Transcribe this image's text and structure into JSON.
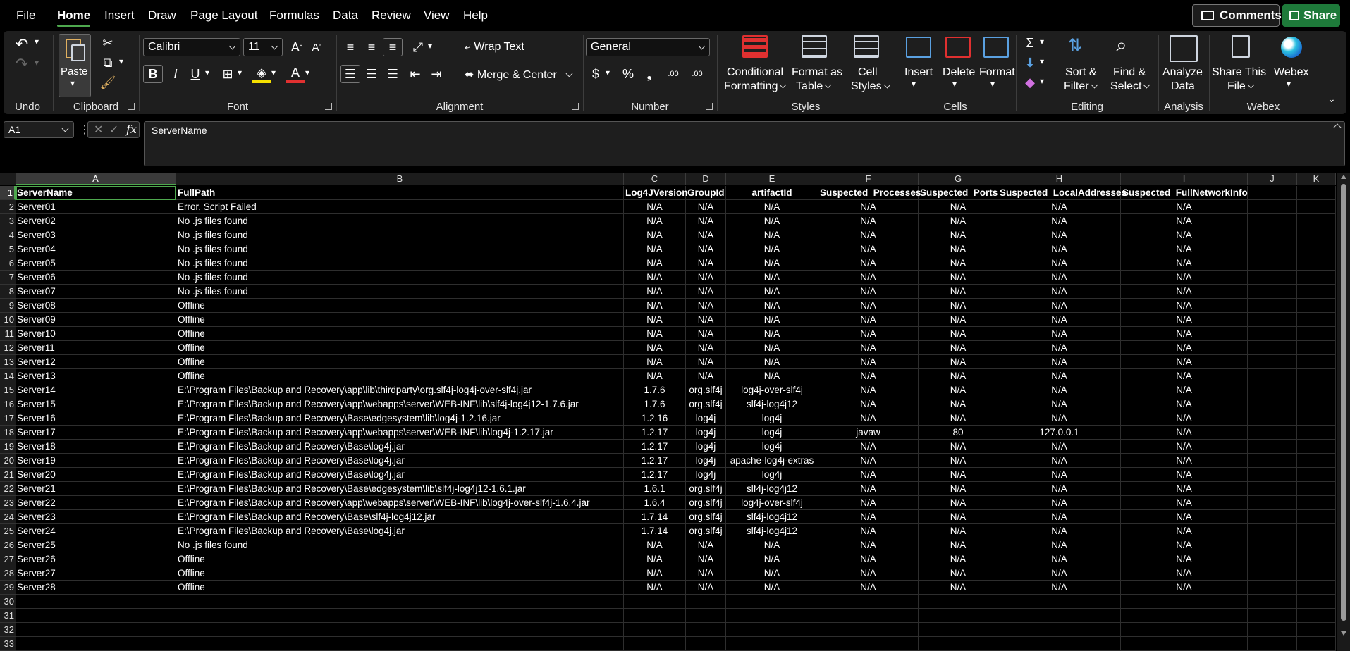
{
  "menu": {
    "items": [
      "File",
      "Home",
      "Insert",
      "Draw",
      "Page Layout",
      "Formulas",
      "Data",
      "Review",
      "View",
      "Help"
    ],
    "active": "Home",
    "comments_label": "Comments",
    "share_label": "Share"
  },
  "ribbon": {
    "undo": {
      "label": "Undo"
    },
    "clipboard": {
      "label": "Clipboard",
      "paste_label": "Paste"
    },
    "font": {
      "label": "Font",
      "font_name": "Calibri",
      "font_size": "11",
      "bold": "B",
      "italic": "I",
      "underline": "U",
      "grow": "A",
      "shrink": "A"
    },
    "alignment": {
      "label": "Alignment",
      "wrap_text": "Wrap Text",
      "merge_center": "Merge & Center"
    },
    "number": {
      "label": "Number",
      "format": "General",
      "currency": "$",
      "percent": "%",
      "comma": "❟",
      "inc_decimal": ".00",
      "dec_decimal": ".00"
    },
    "styles": {
      "label": "Styles",
      "conditional_1": "Conditional",
      "conditional_2": "Formatting",
      "format_table_1": "Format as",
      "format_table_2": "Table",
      "cell_styles_1": "Cell",
      "cell_styles_2": "Styles"
    },
    "cells": {
      "label": "Cells",
      "insert": "Insert",
      "delete": "Delete",
      "format": "Format"
    },
    "editing": {
      "label": "Editing",
      "sort_1": "Sort &",
      "sort_2": "Filter",
      "find_1": "Find &",
      "find_2": "Select"
    },
    "analysis": {
      "label": "Analysis",
      "analyze_1": "Analyze",
      "analyze_2": "Data"
    },
    "webex": {
      "label": "Webex",
      "share_1": "Share This",
      "share_2": "File",
      "webex": "Webex"
    }
  },
  "formula_bar": {
    "name_box": "A1",
    "fx": "fx",
    "value": "ServerName"
  },
  "sheet": {
    "columns": [
      "A",
      "B",
      "C",
      "D",
      "E",
      "F",
      "G",
      "H",
      "I",
      "J",
      "K"
    ],
    "row_numbers": [
      "1",
      "2",
      "3",
      "4",
      "5",
      "6",
      "7",
      "8",
      "9",
      "10",
      "11",
      "12",
      "13",
      "14",
      "15",
      "16",
      "17",
      "18",
      "19",
      "20",
      "21",
      "22",
      "23",
      "24",
      "25",
      "26",
      "27",
      "28",
      "29",
      "30",
      "31",
      "32",
      "33"
    ],
    "headers": [
      "ServerName",
      "FullPath",
      "Log4JVersion",
      "GroupId",
      "artifactId",
      "Suspected_Processes",
      "Suspected_Ports",
      "Suspected_LocalAddresses",
      "Suspected_FullNetworkInfo"
    ],
    "rows": [
      [
        "Server01",
        "Error, Script Failed",
        "N/A",
        "N/A",
        "N/A",
        "N/A",
        "N/A",
        "N/A",
        "N/A"
      ],
      [
        "Server02",
        "No .js files found",
        "N/A",
        "N/A",
        "N/A",
        "N/A",
        "N/A",
        "N/A",
        "N/A"
      ],
      [
        "Server03",
        "No .js files found",
        "N/A",
        "N/A",
        "N/A",
        "N/A",
        "N/A",
        "N/A",
        "N/A"
      ],
      [
        "Server04",
        "No .js files found",
        "N/A",
        "N/A",
        "N/A",
        "N/A",
        "N/A",
        "N/A",
        "N/A"
      ],
      [
        "Server05",
        "No .js files found",
        "N/A",
        "N/A",
        "N/A",
        "N/A",
        "N/A",
        "N/A",
        "N/A"
      ],
      [
        "Server06",
        "No .js files found",
        "N/A",
        "N/A",
        "N/A",
        "N/A",
        "N/A",
        "N/A",
        "N/A"
      ],
      [
        "Server07",
        "No .js files found",
        "N/A",
        "N/A",
        "N/A",
        "N/A",
        "N/A",
        "N/A",
        "N/A"
      ],
      [
        "Server08",
        "Offline",
        "N/A",
        "N/A",
        "N/A",
        "N/A",
        "N/A",
        "N/A",
        "N/A"
      ],
      [
        "Server09",
        "Offline",
        "N/A",
        "N/A",
        "N/A",
        "N/A",
        "N/A",
        "N/A",
        "N/A"
      ],
      [
        "Server10",
        "Offline",
        "N/A",
        "N/A",
        "N/A",
        "N/A",
        "N/A",
        "N/A",
        "N/A"
      ],
      [
        "Server11",
        "Offline",
        "N/A",
        "N/A",
        "N/A",
        "N/A",
        "N/A",
        "N/A",
        "N/A"
      ],
      [
        "Server12",
        "Offline",
        "N/A",
        "N/A",
        "N/A",
        "N/A",
        "N/A",
        "N/A",
        "N/A"
      ],
      [
        "Server13",
        "Offline",
        "N/A",
        "N/A",
        "N/A",
        "N/A",
        "N/A",
        "N/A",
        "N/A"
      ],
      [
        "Server14",
        "E:\\Program Files\\Backup and Recovery\\app\\lib\\thirdparty\\org.slf4j-log4j-over-slf4j.jar",
        "1.7.6",
        "org.slf4j",
        "log4j-over-slf4j",
        "N/A",
        "N/A",
        "N/A",
        "N/A"
      ],
      [
        "Server15",
        "E:\\Program Files\\Backup and Recovery\\app\\webapps\\server\\WEB-INF\\lib\\slf4j-log4j12-1.7.6.jar",
        "1.7.6",
        "org.slf4j",
        "slf4j-log4j12",
        "N/A",
        "N/A",
        "N/A",
        "N/A"
      ],
      [
        "Server16",
        "E:\\Program Files\\Backup and Recovery\\Base\\edgesystem\\lib\\log4j-1.2.16.jar",
        "1.2.16",
        "log4j",
        "log4j",
        "N/A",
        "N/A",
        "N/A",
        "N/A"
      ],
      [
        "Server17",
        "E:\\Program Files\\Backup and Recovery\\app\\webapps\\server\\WEB-INF\\lib\\log4j-1.2.17.jar",
        "1.2.17",
        "log4j",
        "log4j",
        "javaw",
        "80",
        "127.0.0.1",
        "N/A"
      ],
      [
        "Server18",
        "E:\\Program Files\\Backup and Recovery\\Base\\log4j.jar",
        "1.2.17",
        "log4j",
        "log4j",
        "N/A",
        "N/A",
        "N/A",
        "N/A"
      ],
      [
        "Server19",
        "E:\\Program Files\\Backup and Recovery\\Base\\log4j.jar",
        "1.2.17",
        "log4j",
        "apache-log4j-extras",
        "N/A",
        "N/A",
        "N/A",
        "N/A"
      ],
      [
        "Server20",
        "E:\\Program Files\\Backup and Recovery\\Base\\log4j.jar",
        "1.2.17",
        "log4j",
        "log4j",
        "N/A",
        "N/A",
        "N/A",
        "N/A"
      ],
      [
        "Server21",
        "E:\\Program Files\\Backup and Recovery\\Base\\edgesystem\\lib\\slf4j-log4j12-1.6.1.jar",
        "1.6.1",
        "org.slf4j",
        "slf4j-log4j12",
        "N/A",
        "N/A",
        "N/A",
        "N/A"
      ],
      [
        "Server22",
        "E:\\Program Files\\Backup and Recovery\\app\\webapps\\server\\WEB-INF\\lib\\log4j-over-slf4j-1.6.4.jar",
        "1.6.4",
        "org.slf4j",
        "log4j-over-slf4j",
        "N/A",
        "N/A",
        "N/A",
        "N/A"
      ],
      [
        "Server23",
        "E:\\Program Files\\Backup and Recovery\\Base\\slf4j-log4j12.jar",
        "1.7.14",
        "org.slf4j",
        "slf4j-log4j12",
        "N/A",
        "N/A",
        "N/A",
        "N/A"
      ],
      [
        "Server24",
        "E:\\Program Files\\Backup and Recovery\\Base\\log4j.jar",
        "1.7.14",
        "org.slf4j",
        "slf4j-log4j12",
        "N/A",
        "N/A",
        "N/A",
        "N/A"
      ],
      [
        "Server25",
        "No .js files found",
        "N/A",
        "N/A",
        "N/A",
        "N/A",
        "N/A",
        "N/A",
        "N/A"
      ],
      [
        "Server26",
        "Offline",
        "N/A",
        "N/A",
        "N/A",
        "N/A",
        "N/A",
        "N/A",
        "N/A"
      ],
      [
        "Server27",
        "Offline",
        "N/A",
        "N/A",
        "N/A",
        "N/A",
        "N/A",
        "N/A",
        "N/A"
      ],
      [
        "Server28",
        "Offline",
        "N/A",
        "N/A",
        "N/A",
        "N/A",
        "N/A",
        "N/A",
        "N/A"
      ]
    ],
    "selected_cell": "A1"
  },
  "colors": {
    "accent": "#4ea84e",
    "background": "#000000",
    "ribbon": "#1e1e1e",
    "share": "#1e7a3a"
  }
}
